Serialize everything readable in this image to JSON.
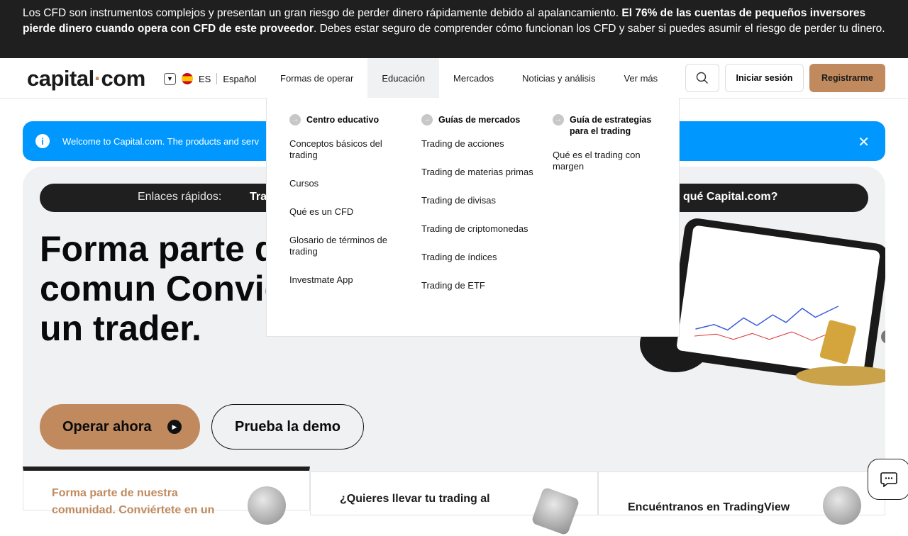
{
  "risk_banner": {
    "text_before": "Los CFD son instrumentos complejos y presentan un gran riesgo de perder dinero rápidamente debido al apalancamiento. ",
    "text_bold": "El 76% de las cuentas de pequeños inversores pierde dinero cuando opera con CFD de este proveedor",
    "text_after": ". Debes estar seguro de comprender cómo funcionan los CFD y saber si puedes asumir el riesgo de perder tu dinero."
  },
  "header": {
    "logo_main": "capital",
    "logo_dot": "·",
    "logo_tld": "com",
    "lang_code": "ES",
    "lang_name": "Español",
    "nav": [
      "Formas de operar",
      "Educación",
      "Mercados",
      "Noticias y análisis",
      "Ver más"
    ],
    "login": "Iniciar sesión",
    "register": "Registrarme"
  },
  "info_bar": {
    "text": "Welcome to Capital.com. The products and serv"
  },
  "quick_links": {
    "label": "Enlaces rápidos:",
    "first": "Tra",
    "last": "qué Capital.com?"
  },
  "hero": {
    "title": "Forma parte d nuestra comun Conviértete en un trader.",
    "cta_trade": "Operar ahora",
    "cta_demo": "Prueba la demo"
  },
  "mega_menu": {
    "columns": [
      {
        "title": "Centro educativo",
        "links": [
          "Conceptos básicos del trading",
          "Cursos",
          "Qué es un CFD",
          "Glosario de términos de trading",
          "Investmate App"
        ]
      },
      {
        "title": "Guías de mercados",
        "links": [
          "Trading de acciones",
          "Trading de materias primas",
          "Trading de divisas",
          "Trading de criptomonedas",
          "Trading de índices",
          "Trading de ETF"
        ]
      },
      {
        "title": "Guía de estrategias para el trading",
        "links": [
          "Qué es el trading con margen"
        ]
      }
    ]
  },
  "cards": [
    {
      "title": "Forma parte de nuestra comunidad. Conviértete en un"
    },
    {
      "title": "¿Quieres llevar tu trading al"
    },
    {
      "title": "Encuéntranos en TradingView"
    }
  ],
  "colors": {
    "accent": "#c08a5e",
    "info": "#0098ff",
    "dark": "#1f1f1f",
    "hero_bg": "#f0f1f3"
  }
}
